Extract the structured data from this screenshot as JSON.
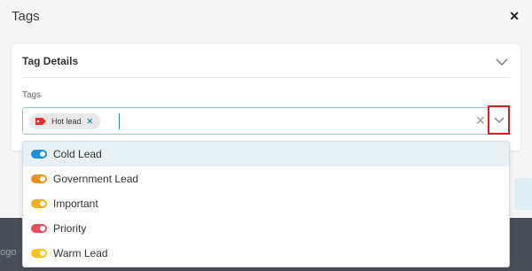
{
  "modal": {
    "title": "Tags"
  },
  "card": {
    "title": "Tag Details"
  },
  "field": {
    "label": "Tags"
  },
  "selected_chip": {
    "label": "Hot lead",
    "color": "#e52b2b"
  },
  "options": [
    {
      "label": "Cold Lead",
      "color": "#1f8fe0",
      "active": true
    },
    {
      "label": "Government Lead",
      "color": "#f0921a",
      "active": false
    },
    {
      "label": "Important",
      "color": "#f2b01a",
      "active": false
    },
    {
      "label": "Priority",
      "color": "#e5505c",
      "active": false
    },
    {
      "label": "Warm Lead",
      "color": "#f5c518",
      "active": false
    }
  ],
  "background": {
    "partial_text": "Logo"
  },
  "colors": {
    "accent": "#2a8fa0",
    "highlight_border": "#e41a1a"
  }
}
